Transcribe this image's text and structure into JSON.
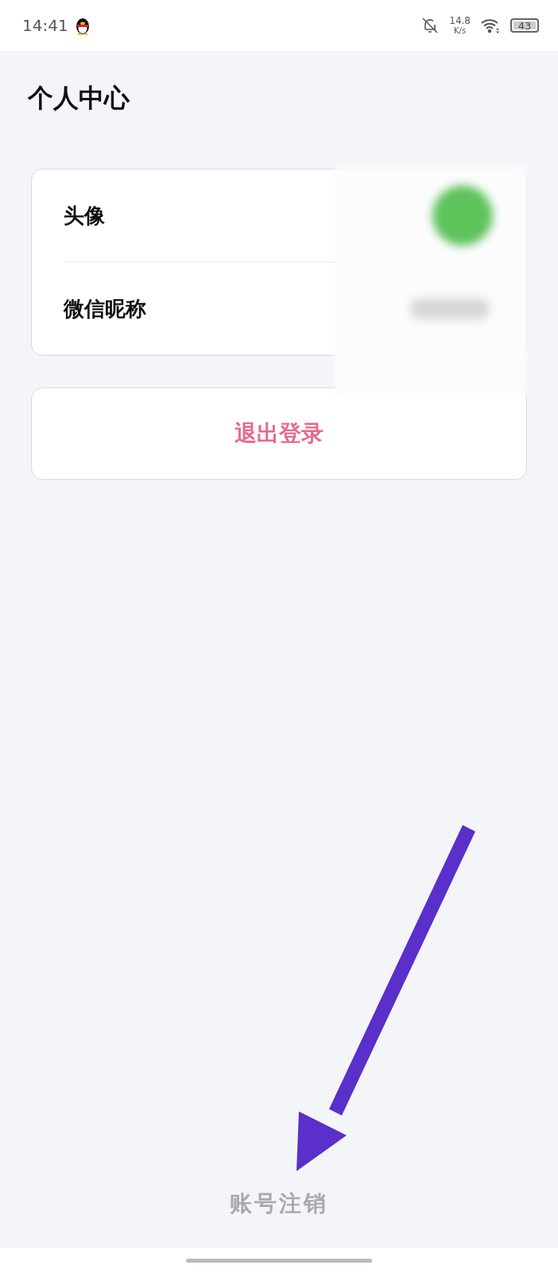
{
  "status_bar": {
    "time": "14:41",
    "network_speed": "14.8",
    "speed_unit": "K/s",
    "battery": "43"
  },
  "title": "个人中心",
  "profile_rows": [
    {
      "label": "头像",
      "kind": "avatar"
    },
    {
      "label": "微信昵称",
      "kind": "nickname"
    }
  ],
  "logout_button": "退出登录",
  "cancel_account_link": "账号注销"
}
